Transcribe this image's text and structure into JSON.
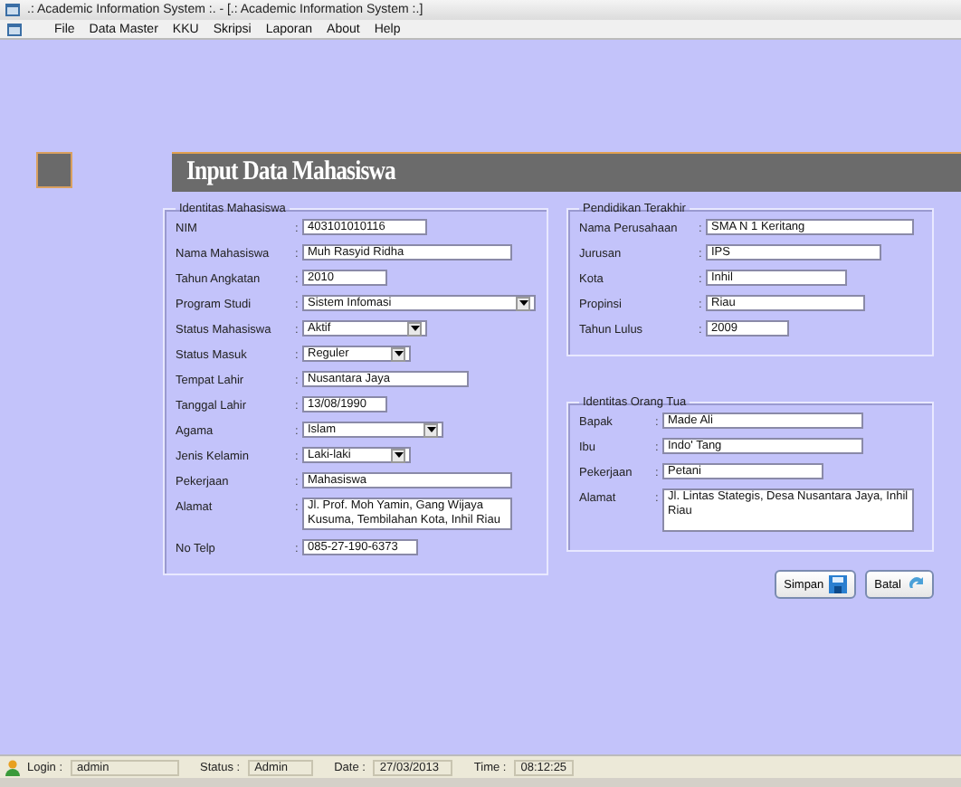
{
  "window": {
    "title": ".: Academic Information System :. - [.: Academic Information System :.]"
  },
  "menu": [
    "File",
    "Data Master",
    "KKU",
    "Skripsi",
    "Laporan",
    "About",
    "Help"
  ],
  "header": {
    "title": "Input Data Mahasiswa"
  },
  "student": {
    "title": "Identitas Mahasiswa",
    "fields": [
      {
        "label": "NIM",
        "sep": ":",
        "kind": "text",
        "value": "403101010116"
      },
      {
        "label": "Nama Mahasiswa",
        "sep": ":",
        "kind": "text",
        "value": "Muh Rasyid Ridha"
      },
      {
        "label": "Tahun Angkatan",
        "sep": ":",
        "kind": "text",
        "value": "2010"
      },
      {
        "label": "Program Studi",
        "sep": ":",
        "kind": "select",
        "value": "Sistem Infomasi"
      },
      {
        "label": "Status Mahasiswa",
        "sep": ":",
        "kind": "select",
        "value": "Aktif"
      },
      {
        "label": "Status Masuk",
        "sep": ":",
        "kind": "select",
        "value": "Reguler"
      },
      {
        "label": "Tempat Lahir",
        "sep": ":",
        "kind": "text",
        "value": "Nusantara Jaya"
      },
      {
        "label": "Tanggal Lahir",
        "sep": ":",
        "kind": "text",
        "value": "13/08/1990"
      },
      {
        "label": "Agama",
        "sep": ":",
        "kind": "select",
        "value": "Islam"
      },
      {
        "label": "Jenis Kelamin",
        "sep": ":",
        "kind": "select",
        "value": "Laki-laki"
      },
      {
        "label": "Pekerjaan",
        "sep": ":",
        "kind": "text",
        "value": "Mahasiswa"
      },
      {
        "label": "Alamat",
        "sep": ":",
        "kind": "textarea",
        "value": "Jl. Prof. Moh Yamin, Gang Wijaya Kusuma, Tembilahan Kota, Inhil Riau"
      },
      {
        "label": "No Telp",
        "sep": ":",
        "kind": "text",
        "value": "085-27-190-6373"
      }
    ]
  },
  "education": {
    "title": "Pendidikan Terakhir",
    "fields": [
      {
        "label": "Nama Perusahaan",
        "sep": ":",
        "kind": "text",
        "value": "SMA N 1 Keritang"
      },
      {
        "label": "Jurusan",
        "sep": ":",
        "kind": "text",
        "value": "IPS"
      },
      {
        "label": "Kota",
        "sep": ":",
        "kind": "text",
        "value": "Inhil"
      },
      {
        "label": "Propinsi",
        "sep": ":",
        "kind": "text",
        "value": "Riau"
      },
      {
        "label": "Tahun Lulus",
        "sep": ":",
        "kind": "text",
        "value": "2009"
      }
    ]
  },
  "parents": {
    "title": "Identitas Orang Tua",
    "fields": [
      {
        "label": "Bapak",
        "sep": ":",
        "kind": "text",
        "value": "Made Ali"
      },
      {
        "label": "Ibu",
        "sep": ":",
        "kind": "text",
        "value": "Indo' Tang"
      },
      {
        "label": "Pekerjaan",
        "sep": ":",
        "kind": "text",
        "value": "Petani"
      },
      {
        "label": "Alamat",
        "sep": ":",
        "kind": "textarea",
        "value": "Jl. Lintas Stategis, Desa Nusantara Jaya, Inhil Riau"
      }
    ]
  },
  "buttons": [
    {
      "label": "Simpan",
      "kind": "save"
    },
    {
      "label": "Batal",
      "kind": "cancel"
    }
  ],
  "status_bar": [
    {
      "label": "Login :",
      "value": "admin"
    },
    {
      "label": "Status :",
      "value": "Admin"
    },
    {
      "label": "Date :",
      "value": "27/03/2013"
    },
    {
      "label": "Time :",
      "value": "08:12:25"
    }
  ]
}
